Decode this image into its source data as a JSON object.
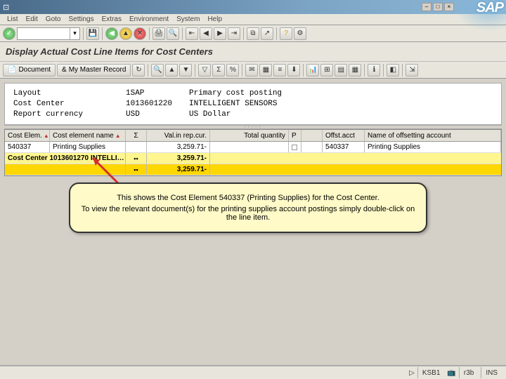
{
  "menu": [
    "List",
    "Edit",
    "Goto",
    "Settings",
    "Extras",
    "Environment",
    "System",
    "Help"
  ],
  "page_title": "Display Actual Cost Line Items for Cost Centers",
  "toolbar2": {
    "document": "Document",
    "master": "My Master Record"
  },
  "info": {
    "rows": [
      {
        "label": "Layout",
        "val": "1SAP",
        "desc": "Primary cost posting"
      },
      {
        "label": "Cost Center",
        "val": "1013601220",
        "desc": "INTELLIGENT SENSORS"
      },
      {
        "label": "Report currency",
        "val": "USD",
        "desc": "US Dollar"
      }
    ]
  },
  "grid": {
    "headers": [
      "Cost Elem.",
      "Cost element name",
      "Σ",
      "Val.in rep.cur.",
      "Total quantity",
      "P",
      "",
      "Offst.acct",
      "Name of offsetting account"
    ],
    "row": {
      "cost_elem": "540337",
      "name": "Printing Supplies",
      "val": "3,259.71-",
      "offset": "540337",
      "offsetname": "Printing Supplies"
    },
    "subtotal": {
      "label": "Cost Center 1013601270 INTELLI…",
      "val": "3,259.71-"
    },
    "total": {
      "val": "3,259.71-"
    }
  },
  "callout": {
    "line1": "This shows the Cost Element 540337 (Printing Supplies) for the Cost Center.",
    "line2": "To view the relevant document(s) for the printing supplies account postings simply double-click on the line item."
  },
  "status": {
    "f1": "KSB1",
    "f2": "r3b",
    "f3": "INS"
  }
}
